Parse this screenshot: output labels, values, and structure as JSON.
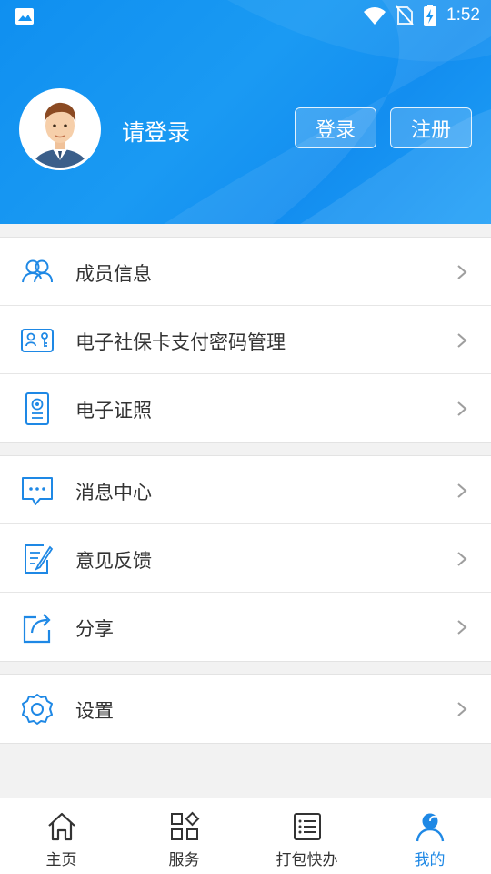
{
  "status_bar": {
    "time": "1:52"
  },
  "header": {
    "login_prompt": "请登录",
    "login_button": "登录",
    "register_button": "注册"
  },
  "menu_groups": [
    {
      "items": [
        {
          "label": "成员信息",
          "icon": "members-icon"
        },
        {
          "label": "电子社保卡支付密码管理",
          "icon": "social-card-icon"
        },
        {
          "label": "电子证照",
          "icon": "license-icon"
        }
      ]
    },
    {
      "items": [
        {
          "label": "消息中心",
          "icon": "message-icon"
        },
        {
          "label": "意见反馈",
          "icon": "feedback-icon"
        },
        {
          "label": "分享",
          "icon": "share-icon"
        }
      ]
    },
    {
      "items": [
        {
          "label": "设置",
          "icon": "settings-icon"
        }
      ]
    }
  ],
  "tabbar": {
    "tabs": [
      {
        "label": "主页",
        "icon": "home-icon"
      },
      {
        "label": "服务",
        "icon": "services-icon"
      },
      {
        "label": "打包快办",
        "icon": "list-icon"
      },
      {
        "label": "我的",
        "icon": "profile-icon"
      }
    ],
    "active_index": 3
  },
  "colors": {
    "accent": "#1e88e5",
    "header": "#1594f2"
  }
}
